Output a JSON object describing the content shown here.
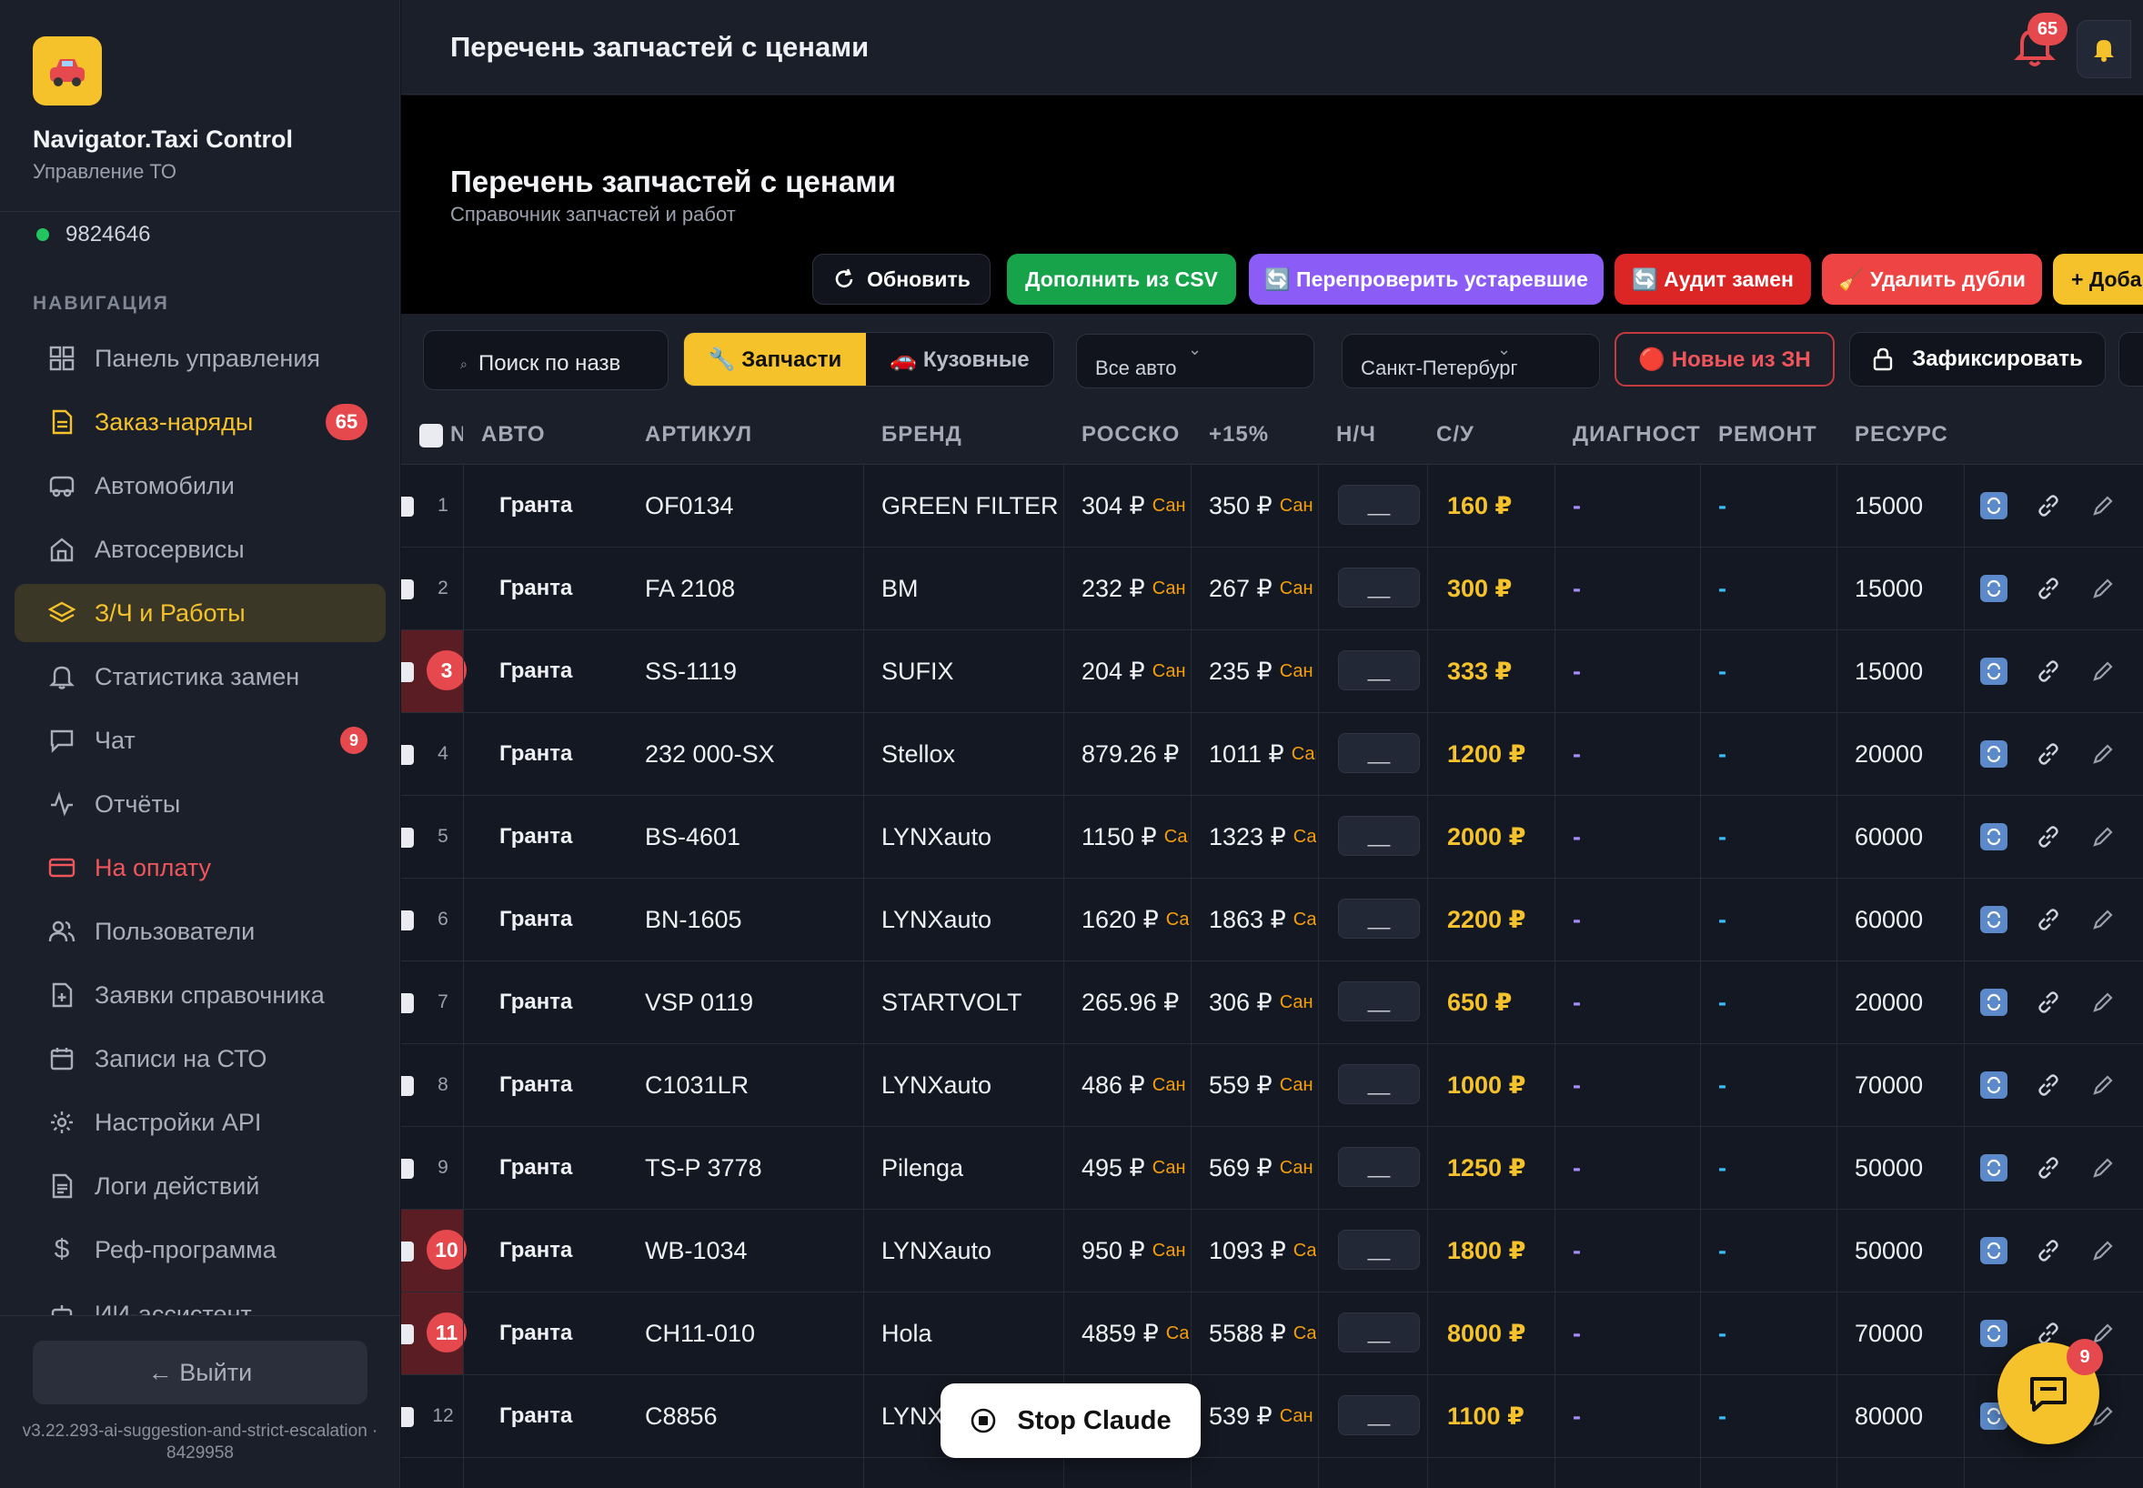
{
  "sidebar": {
    "app_title": "Navigator.Taxi Control",
    "app_subtitle": "Управление ТО",
    "user_id": "9824646",
    "nav_heading": "НАВИГАЦИЯ",
    "items": [
      {
        "label": "Панель управления",
        "icon": "grid-icon"
      },
      {
        "label": "Заказ-наряды",
        "icon": "document-icon",
        "badge": "65"
      },
      {
        "label": "Автомобили",
        "icon": "car-icon"
      },
      {
        "label": "Автосервисы",
        "icon": "building-icon"
      },
      {
        "label": "З/Ч и Работы",
        "icon": "layers-icon"
      },
      {
        "label": "Статистика замен",
        "icon": "bell-icon"
      },
      {
        "label": "Чат",
        "icon": "chat-icon",
        "badge": "9"
      },
      {
        "label": "Отчёты",
        "icon": "activity-icon"
      },
      {
        "label": "На оплату",
        "icon": "credit-card-icon"
      },
      {
        "label": "Пользователи",
        "icon": "users-icon"
      },
      {
        "label": "Заявки справочника",
        "icon": "file-plus-icon"
      },
      {
        "label": "Записи на СТО",
        "icon": "calendar-icon"
      },
      {
        "label": "Настройки API",
        "icon": "gear-icon"
      },
      {
        "label": "Логи действий",
        "icon": "log-icon"
      },
      {
        "label": "Реф-программа",
        "icon": "dollar-icon"
      },
      {
        "label": "ИИ-ассистент",
        "icon": "bot-icon"
      }
    ],
    "logout_label": "← Выйти",
    "version": "v3.22.293-ai-suggestion-and-strict-escalation · 8429958"
  },
  "topbar": {
    "title": "Перечень запчастей с ценами",
    "notifications_count": "65"
  },
  "page": {
    "title": "Перечень запчастей с ценами",
    "subtitle": "Справочник запчастей и работ",
    "buttons": {
      "refresh": "Обновить",
      "import_csv": "Дополнить из CSV",
      "recheck": "🔄 Перепроверить устаревшие",
      "audit": "🔄 Аудит замен",
      "dedupe": "🧹 Удалить дубли",
      "add": "+ Доба"
    }
  },
  "filters": {
    "search_placeholder": "Поиск по назв",
    "tab_parts": "🔧 Запчасти",
    "tab_body": "🚗 Кузовные",
    "car_select": "Все авто",
    "city_select": "Санкт-Петербург",
    "new_from_wo": "🔴 Новые из ЗН",
    "lock_label": "Зафиксировать"
  },
  "table": {
    "columns": [
      "N",
      "АВТО",
      "АРТИКУЛ",
      "БРЕНД",
      "РОССКО",
      "+15%",
      "Н/Ч",
      "С/У",
      "ДИАГНОСТ",
      "РЕМОНТ",
      "РЕСУРС"
    ],
    "rows": [
      {
        "n": "1",
        "car": "Гранта",
        "article": "OF0134",
        "brand": "GREEN FILTER",
        "rossko": "304 ₽",
        "rossko_tag": "Сан",
        "plus15": "350 ₽",
        "plus15_tag": "Сан",
        "nh": "__",
        "su": "160 ₽",
        "diag": "-",
        "repair": "-",
        "resource": "15000",
        "flag": false
      },
      {
        "n": "2",
        "car": "Гранта",
        "article": "FA 2108",
        "brand": "BM",
        "rossko": "232 ₽",
        "rossko_tag": "Сан",
        "plus15": "267 ₽",
        "plus15_tag": "Сан",
        "nh": "__",
        "su": "300 ₽",
        "diag": "-",
        "repair": "-",
        "resource": "15000",
        "flag": false
      },
      {
        "n": "3",
        "car": "Гранта",
        "article": "SS-1119",
        "brand": "SUFIX",
        "rossko": "204 ₽",
        "rossko_tag": "Сан",
        "plus15": "235 ₽",
        "plus15_tag": "Сан",
        "nh": "__",
        "su": "333 ₽",
        "diag": "-",
        "repair": "-",
        "resource": "15000",
        "flag": true
      },
      {
        "n": "4",
        "car": "Гранта",
        "article": "232 000-SX",
        "brand": "Stellox",
        "rossko": "879.26 ₽",
        "rossko_tag": "",
        "plus15": "1011 ₽",
        "plus15_tag": "Сан",
        "nh": "__",
        "su": "1200 ₽",
        "diag": "-",
        "repair": "-",
        "resource": "20000",
        "flag": false
      },
      {
        "n": "5",
        "car": "Гранта",
        "article": "BS-4601",
        "brand": "LYNXauto",
        "rossko": "1150 ₽",
        "rossko_tag": "Сан",
        "plus15": "1323 ₽",
        "plus15_tag": "Са",
        "nh": "__",
        "su": "2000 ₽",
        "diag": "-",
        "repair": "-",
        "resource": "60000",
        "flag": false
      },
      {
        "n": "6",
        "car": "Гранта",
        "article": "BN-1605",
        "brand": "LYNXauto",
        "rossko": "1620 ₽",
        "rossko_tag": "Са",
        "plus15": "1863 ₽",
        "plus15_tag": "Са",
        "nh": "__",
        "su": "2200 ₽",
        "diag": "-",
        "repair": "-",
        "resource": "60000",
        "flag": false
      },
      {
        "n": "7",
        "car": "Гранта",
        "article": "VSP 0119",
        "brand": "STARTVOLT",
        "rossko": "265.96 ₽",
        "rossko_tag": "",
        "plus15": "306 ₽",
        "plus15_tag": "Сан",
        "nh": "__",
        "su": "650 ₽",
        "diag": "-",
        "repair": "-",
        "resource": "20000",
        "flag": false
      },
      {
        "n": "8",
        "car": "Гранта",
        "article": "C1031LR",
        "brand": "LYNXauto",
        "rossko": "486 ₽",
        "rossko_tag": "Сан",
        "plus15": "559 ₽",
        "plus15_tag": "Сан",
        "nh": "__",
        "su": "1000 ₽",
        "diag": "-",
        "repair": "-",
        "resource": "70000",
        "flag": false
      },
      {
        "n": "9",
        "car": "Гранта",
        "article": "TS-P 3778",
        "brand": "Pilenga",
        "rossko": "495 ₽",
        "rossko_tag": "Сан",
        "plus15": "569 ₽",
        "plus15_tag": "Сан",
        "nh": "__",
        "su": "1250 ₽",
        "diag": "-",
        "repair": "-",
        "resource": "50000",
        "flag": false
      },
      {
        "n": "10",
        "car": "Гранта",
        "article": "WB-1034",
        "brand": "LYNXauto",
        "rossko": "950 ₽",
        "rossko_tag": "Сан",
        "plus15": "1093 ₽",
        "plus15_tag": "Са",
        "nh": "__",
        "su": "1800 ₽",
        "diag": "-",
        "repair": "-",
        "resource": "50000",
        "flag": true
      },
      {
        "n": "11",
        "car": "Гранта",
        "article": "CH11-010",
        "brand": "Hola",
        "rossko": "4859 ₽",
        "rossko_tag": "Са",
        "plus15": "5588 ₽",
        "plus15_tag": "Са",
        "nh": "__",
        "su": "8000 ₽",
        "diag": "-",
        "repair": "-",
        "resource": "70000",
        "flag": true
      },
      {
        "n": "12",
        "car": "Гранта",
        "article": "C8856",
        "brand": "LYNX",
        "rossko": "",
        "rossko_tag": "",
        "plus15": "539 ₽",
        "plus15_tag": "Сан",
        "nh": "__",
        "su": "1100 ₽",
        "diag": "-",
        "repair": "-",
        "resource": "80000",
        "flag": false
      }
    ]
  },
  "floating": {
    "stop_claude": "Stop Claude",
    "chat_badge": "9"
  },
  "colors": {
    "accent": "#f5c22b",
    "danger": "#e5484d",
    "success": "#16a34a",
    "purple": "#8b5cf6"
  }
}
